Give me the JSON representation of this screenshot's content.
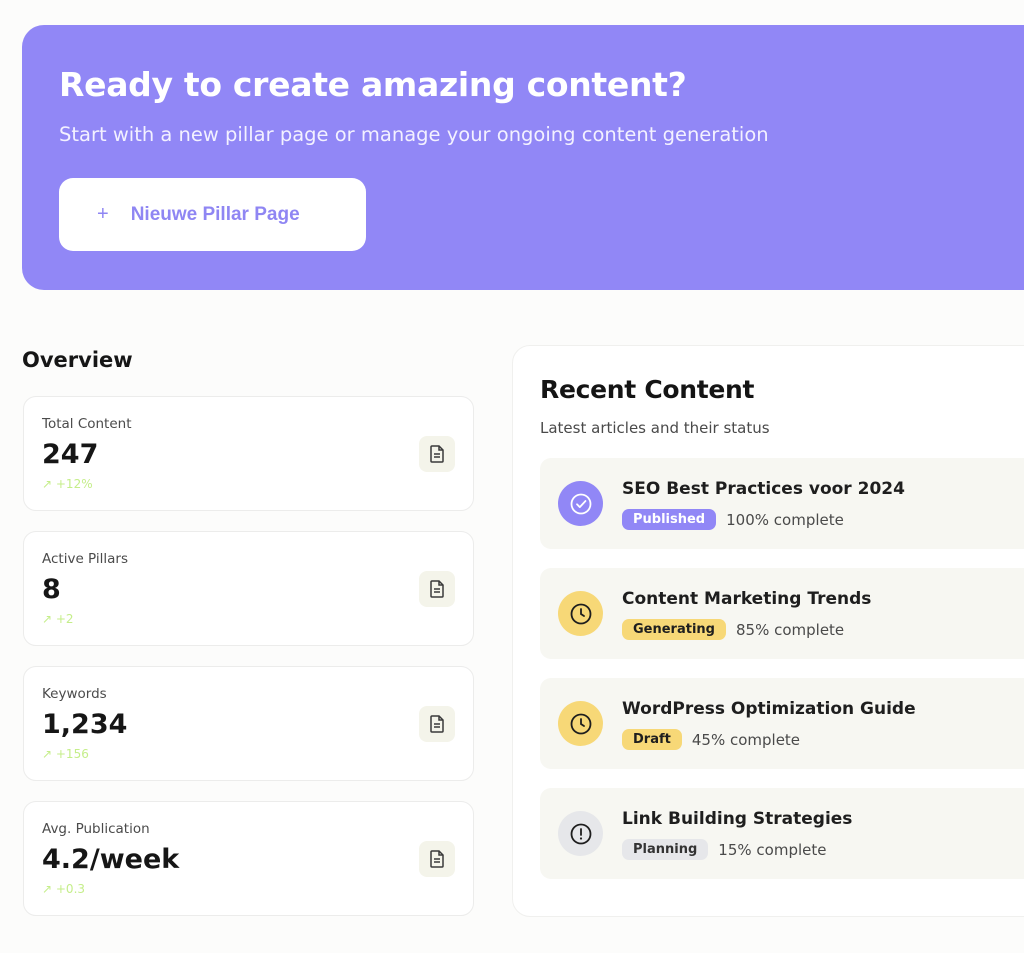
{
  "hero": {
    "title": "Ready to create amazing content?",
    "subtitle": "Start with a new pillar page or manage your ongoing content generation",
    "button_icon": "plus-icon",
    "button_label": "Nieuwe Pillar Page",
    "background_color": "#9187f6"
  },
  "overview": {
    "title": "Overview",
    "stats": [
      {
        "label": "Total Content",
        "value": "247",
        "trend": "+12%",
        "icon": "document-icon"
      },
      {
        "label": "Active Pillars",
        "value": "8",
        "trend": "+2",
        "icon": "document-icon"
      },
      {
        "label": "Keywords",
        "value": "1,234",
        "trend": "+156",
        "icon": "document-icon"
      },
      {
        "label": "Avg. Publication",
        "value": "4.2/week",
        "trend": "+0.3",
        "icon": "document-icon"
      }
    ]
  },
  "recent": {
    "title": "Recent Content",
    "subtitle": "Latest articles and their status",
    "items": [
      {
        "title": "SEO Best Practices voor 2024",
        "status": "Published",
        "progress_text": "100% complete",
        "progress": 100,
        "icon": "check-circle-icon"
      },
      {
        "title": "Content Marketing Trends",
        "status": "Generating",
        "progress_text": "85% complete",
        "progress": 85,
        "icon": "clock-icon"
      },
      {
        "title": "WordPress Optimization Guide",
        "status": "Draft",
        "progress_text": "45% complete",
        "progress": 45,
        "icon": "clock-icon"
      },
      {
        "title": "Link Building Strategies",
        "status": "Planning",
        "progress_text": "15% complete",
        "progress": 15,
        "icon": "alert-circle-icon"
      }
    ]
  },
  "colors": {
    "accent": "#9187f6",
    "published": "#9187f6",
    "generating": "#f7d877",
    "draft": "#f7d877",
    "planning": "#e6e7ea",
    "trend": "#c5ee8a"
  }
}
